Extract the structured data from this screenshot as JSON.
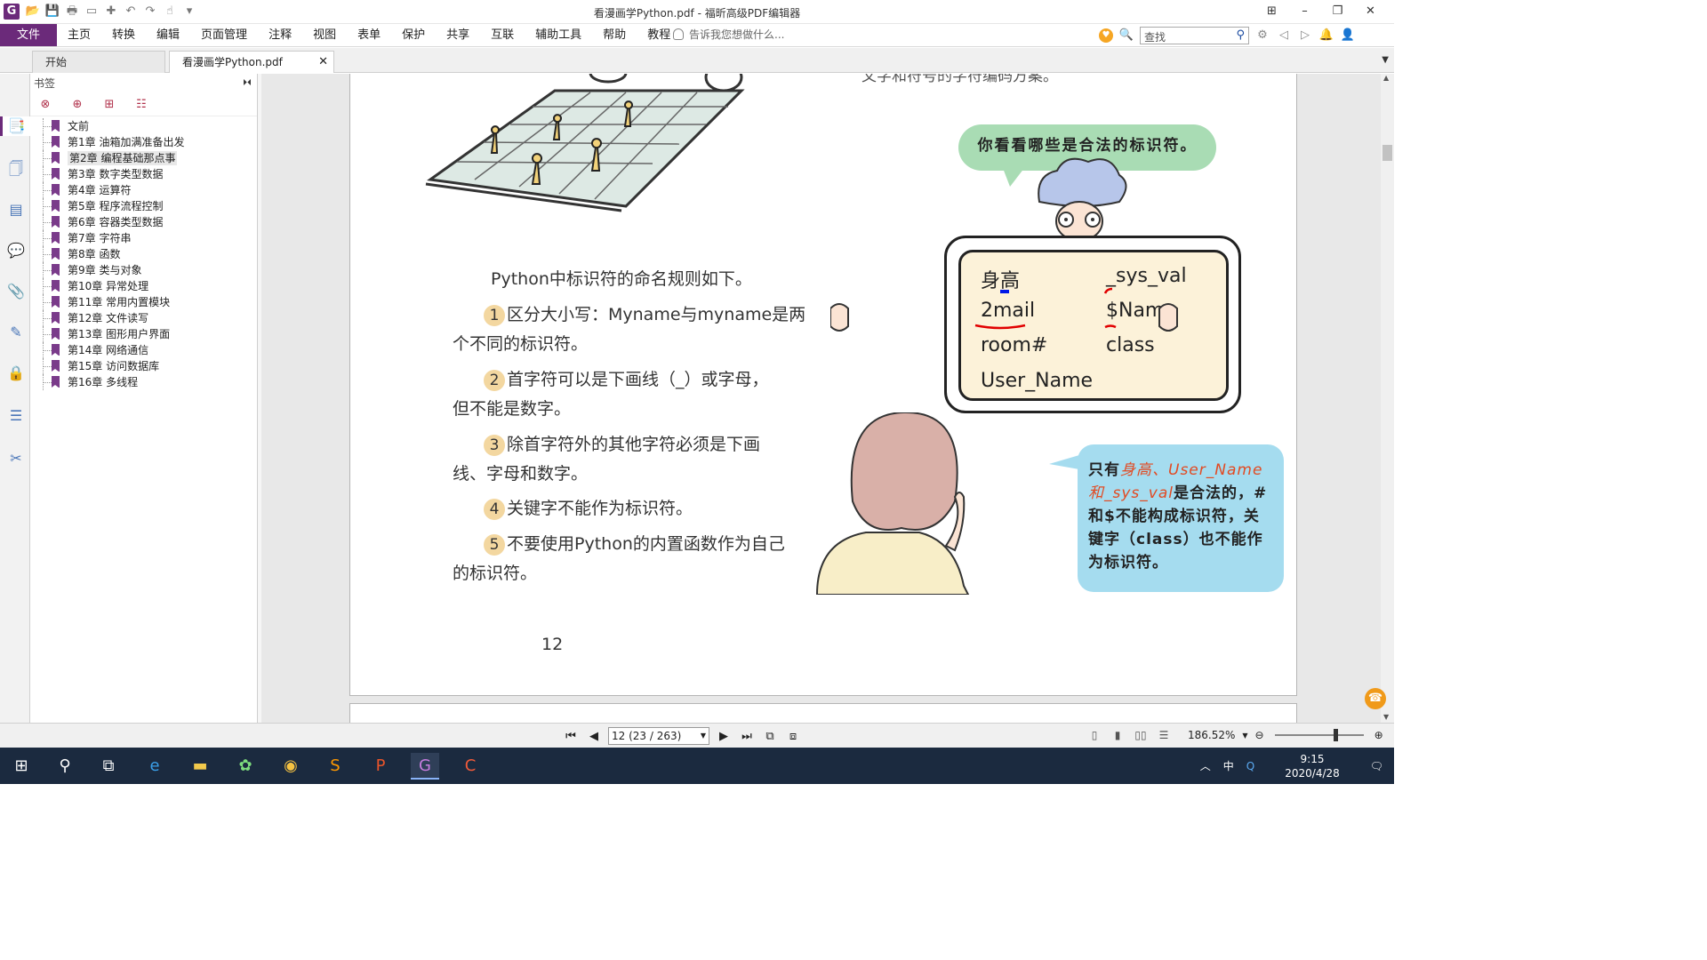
{
  "window": {
    "title": "看漫画学Python.pdf - 福昕高级PDF编辑器",
    "app_icon": "G",
    "controls": [
      "⊞",
      "–",
      "❐",
      "✕"
    ]
  },
  "menu": {
    "file": "文件",
    "items": [
      "主页",
      "转换",
      "编辑",
      "页面管理",
      "注释",
      "视图",
      "表单",
      "保护",
      "共享",
      "互联",
      "辅助工具",
      "帮助",
      "教程"
    ],
    "tellme": "告诉我您想做什么...",
    "search_placeholder": "查找"
  },
  "tabs": [
    {
      "label": "开始"
    },
    {
      "label": "看漫画学Python.pdf"
    }
  ],
  "bookmarks": {
    "header": "书签",
    "items": [
      "文前",
      "第1章 油箱加满准备出发",
      "第2章 编程基础那点事",
      "第3章 数字类型数据",
      "第4章 运算符",
      "第5章 程序流程控制",
      "第6章 容器类型数据",
      "第7章 字符串",
      "第8章 函数",
      "第9章 类与对象",
      "第10章 异常处理",
      "第11章 常用内置模块",
      "第12章 文件读写",
      "第13章 图形用户界面",
      "第14章 网络通信",
      "第15章 访问数据库",
      "第16章 多线程"
    ],
    "selected_index": 2
  },
  "page": {
    "top_fragment": "文字和符号的字符编码方案。",
    "intro": "Python中标识符的命名规则如下。",
    "rules": [
      {
        "n": "1",
        "text": "区分大小写：Myname与myname是两",
        "cont": "个不同的标识符。"
      },
      {
        "n": "2",
        "text": "首字符可以是下画线（_）或字母，",
        "cont": "但不能是数字。"
      },
      {
        "n": "3",
        "text": "除首字符外的其他字符必须是下画",
        "cont": "线、字母和数字。"
      },
      {
        "n": "4",
        "text": "关键字不能作为标识符。",
        "cont": ""
      },
      {
        "n": "5",
        "text": "不要使用Python的内置函数作为自己",
        "cont": "的标识符。"
      }
    ],
    "bubble_top": "你看看哪些是合法的标识符。",
    "board": {
      "c1": [
        "身高",
        "2mail",
        "room#",
        "User_Name"
      ],
      "c2": [
        "_sys_val",
        "$Name",
        "class"
      ]
    },
    "bubble_answer": {
      "p1": "只有",
      "h1": "身高、User_Name",
      "h2": "和_sys_val",
      "p2": "是合法的，#和$不能构成标识符，关键字（class）也不能作为标识符。"
    },
    "page_number": "12"
  },
  "status": {
    "page_input": "12 (23 / 263)",
    "zoom": "186.52%"
  },
  "taskbar": {
    "time": "9:15",
    "date": "2020/4/28",
    "ime": "中"
  }
}
